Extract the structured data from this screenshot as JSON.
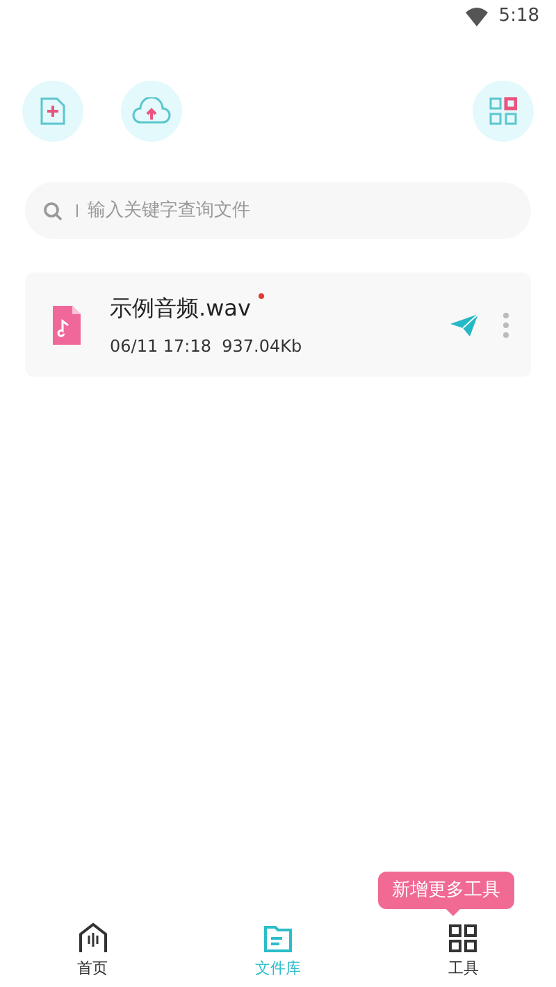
{
  "status_bar": {
    "time": "5:18"
  },
  "search": {
    "placeholder": "输入关键字查询文件"
  },
  "files": [
    {
      "name": "示例音频.wav",
      "unread": true,
      "meta": "06/11 17:18  937.04Kb"
    }
  ],
  "tooltip": "新增更多工具",
  "tabs": [
    {
      "label": "首页",
      "selected": false,
      "kind": "home"
    },
    {
      "label": "文件库",
      "selected": true,
      "kind": "files"
    },
    {
      "label": "工具",
      "selected": false,
      "kind": "tools"
    }
  ]
}
